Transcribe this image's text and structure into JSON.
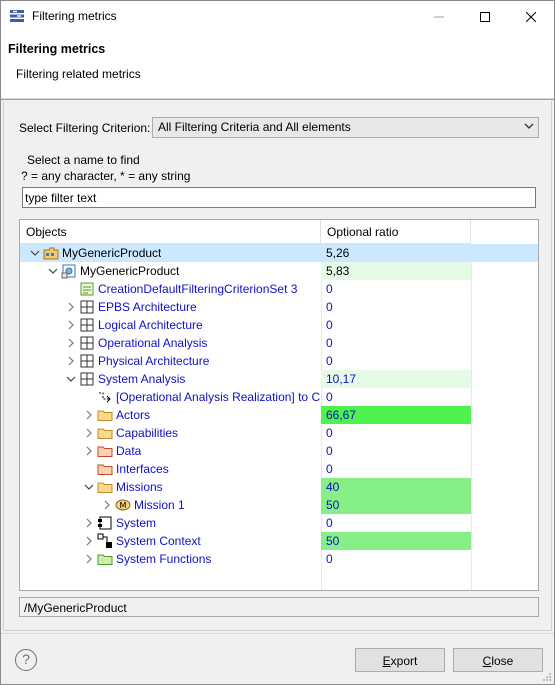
{
  "window": {
    "title": "Filtering metrics",
    "minimize_icon": "minimize-icon",
    "maximize_icon": "maximize-icon",
    "close_icon": "close-icon"
  },
  "header": {
    "title": "Filtering metrics",
    "description": "Filtering related metrics"
  },
  "criterion": {
    "label": "Select Filtering Criterion:",
    "value": "All Filtering Criteria and All elements"
  },
  "find": {
    "title": "Select a name to find",
    "help": "? = any character, * = any string",
    "placeholder": "type filter text"
  },
  "tree": {
    "columns": [
      "Objects",
      "Optional ratio"
    ],
    "rows": [
      {
        "label": "MyGenericProduct",
        "value": "5,26",
        "icon": "project-folder-icon",
        "expand": "expanded"
      },
      {
        "label": "MyGenericProduct",
        "value": "5,83",
        "icon": "system-engineering-icon",
        "expand": "expanded"
      },
      {
        "label": "CreationDefaultFilteringCriterionSet 3",
        "value": "0",
        "icon": "criterion-set-icon",
        "expand": "none"
      },
      {
        "label": "EPBS Architecture",
        "value": "0",
        "icon": "architecture-grid-icon",
        "expand": "collapsed"
      },
      {
        "label": "Logical Architecture",
        "value": "0",
        "icon": "architecture-grid-icon",
        "expand": "collapsed"
      },
      {
        "label": "Operational Analysis",
        "value": "0",
        "icon": "architecture-grid-icon",
        "expand": "collapsed"
      },
      {
        "label": "Physical Architecture",
        "value": "0",
        "icon": "architecture-grid-icon",
        "expand": "collapsed"
      },
      {
        "label": "System Analysis",
        "value": "10,17",
        "icon": "architecture-grid-icon",
        "expand": "expanded"
      },
      {
        "label": "[Operational Analysis Realization] to C",
        "value": "0",
        "icon": "realization-arrow-icon",
        "expand": "none"
      },
      {
        "label": "Actors",
        "value": "66,67",
        "icon": "folder-orange-icon",
        "expand": "collapsed"
      },
      {
        "label": "Capabilities",
        "value": "0",
        "icon": "folder-orange-icon",
        "expand": "collapsed"
      },
      {
        "label": "Data",
        "value": "0",
        "icon": "folder-red-icon",
        "expand": "collapsed"
      },
      {
        "label": "Interfaces",
        "value": "0",
        "icon": "folder-red-icon",
        "expand": "none"
      },
      {
        "label": "Missions",
        "value": "40",
        "icon": "folder-orange-icon",
        "expand": "expanded"
      },
      {
        "label": "Mission 1",
        "value": "50",
        "icon": "mission-icon",
        "expand": "collapsed"
      },
      {
        "label": "System",
        "value": "0",
        "icon": "system-component-icon",
        "expand": "collapsed"
      },
      {
        "label": "System Context",
        "value": "50",
        "icon": "system-context-icon",
        "expand": "collapsed"
      },
      {
        "label": "System Functions",
        "value": "0",
        "icon": "folder-green-icon",
        "expand": "collapsed"
      }
    ]
  },
  "path": "/MyGenericProduct",
  "buttons": {
    "help_icon": "help-icon",
    "export": "Export",
    "close": "Close"
  },
  "colors": {
    "selection": "#cce8ff",
    "ratio_light": "#e6fbe6",
    "ratio_mid": "#86ef86",
    "ratio_strong": "#4df24d",
    "link_text": "#1010c8"
  }
}
